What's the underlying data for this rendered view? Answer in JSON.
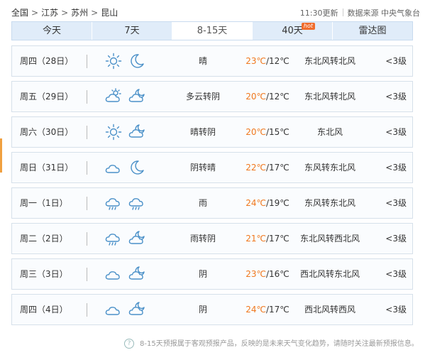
{
  "breadcrumb": {
    "items": [
      "全国",
      "江苏",
      "苏州",
      "昆山"
    ],
    "separator": ">"
  },
  "header": {
    "update_time": "11:30更新",
    "source_label": "数据来源 中央气象台"
  },
  "tabs": [
    {
      "label": "今天",
      "active": false
    },
    {
      "label": "7天",
      "active": false
    },
    {
      "label": "8-15天",
      "active": true
    },
    {
      "label": "40天",
      "active": false,
      "badge": "hot"
    },
    {
      "label": "雷达图",
      "active": false
    }
  ],
  "forecast": [
    {
      "day": "周四（28日）",
      "icons": [
        "sun-icon",
        "moon-icon"
      ],
      "condition": "晴",
      "high": "23℃",
      "low": "12℃",
      "wind": "东北风转北风",
      "level": "<3级"
    },
    {
      "day": "周五（29日）",
      "icons": [
        "partly-cloudy-day-icon",
        "partly-cloudy-night-icon"
      ],
      "condition": "多云转阴",
      "high": "20℃",
      "low": "12℃",
      "wind": "东北风转北风",
      "level": "<3级"
    },
    {
      "day": "周六（30日）",
      "icons": [
        "sun-icon",
        "partly-cloudy-night-icon"
      ],
      "condition": "晴转阴",
      "high": "20℃",
      "low": "15℃",
      "wind": "东北风",
      "level": "<3级"
    },
    {
      "day": "周日（31日）",
      "icons": [
        "cloud-icon",
        "moon-icon"
      ],
      "condition": "阴转晴",
      "high": "22℃",
      "low": "17℃",
      "wind": "东风转东北风",
      "level": "<3级"
    },
    {
      "day": "周一（1日）",
      "icons": [
        "rain-icon",
        "rain-icon"
      ],
      "condition": "雨",
      "high": "24℃",
      "low": "19℃",
      "wind": "东风转东北风",
      "level": "<3级"
    },
    {
      "day": "周二（2日）",
      "icons": [
        "rain-icon",
        "partly-cloudy-night-icon"
      ],
      "condition": "雨转阴",
      "high": "21℃",
      "low": "17℃",
      "wind": "东北风转西北风",
      "level": "<3级"
    },
    {
      "day": "周三（3日）",
      "icons": [
        "cloud-icon",
        "partly-cloudy-night-icon"
      ],
      "condition": "阴",
      "high": "23℃",
      "low": "16℃",
      "wind": "西北风转东北风",
      "level": "<3级"
    },
    {
      "day": "周四（4日）",
      "icons": [
        "cloud-icon",
        "partly-cloudy-night-icon"
      ],
      "condition": "阴",
      "high": "24℃",
      "low": "17℃",
      "wind": "西北风转西风",
      "level": "<3级"
    }
  ],
  "footer": {
    "help_icon": "question-icon",
    "note": "8-15天预报属于客观预报产品，反映的是未来天气变化趋势，请随时关注最新预报信息。"
  },
  "colors": {
    "tab_bg": "#e0ecf9",
    "high_temp": "#f0781e",
    "icon_stroke": "#4a90c8",
    "hot_badge": "#f06d2c"
  }
}
